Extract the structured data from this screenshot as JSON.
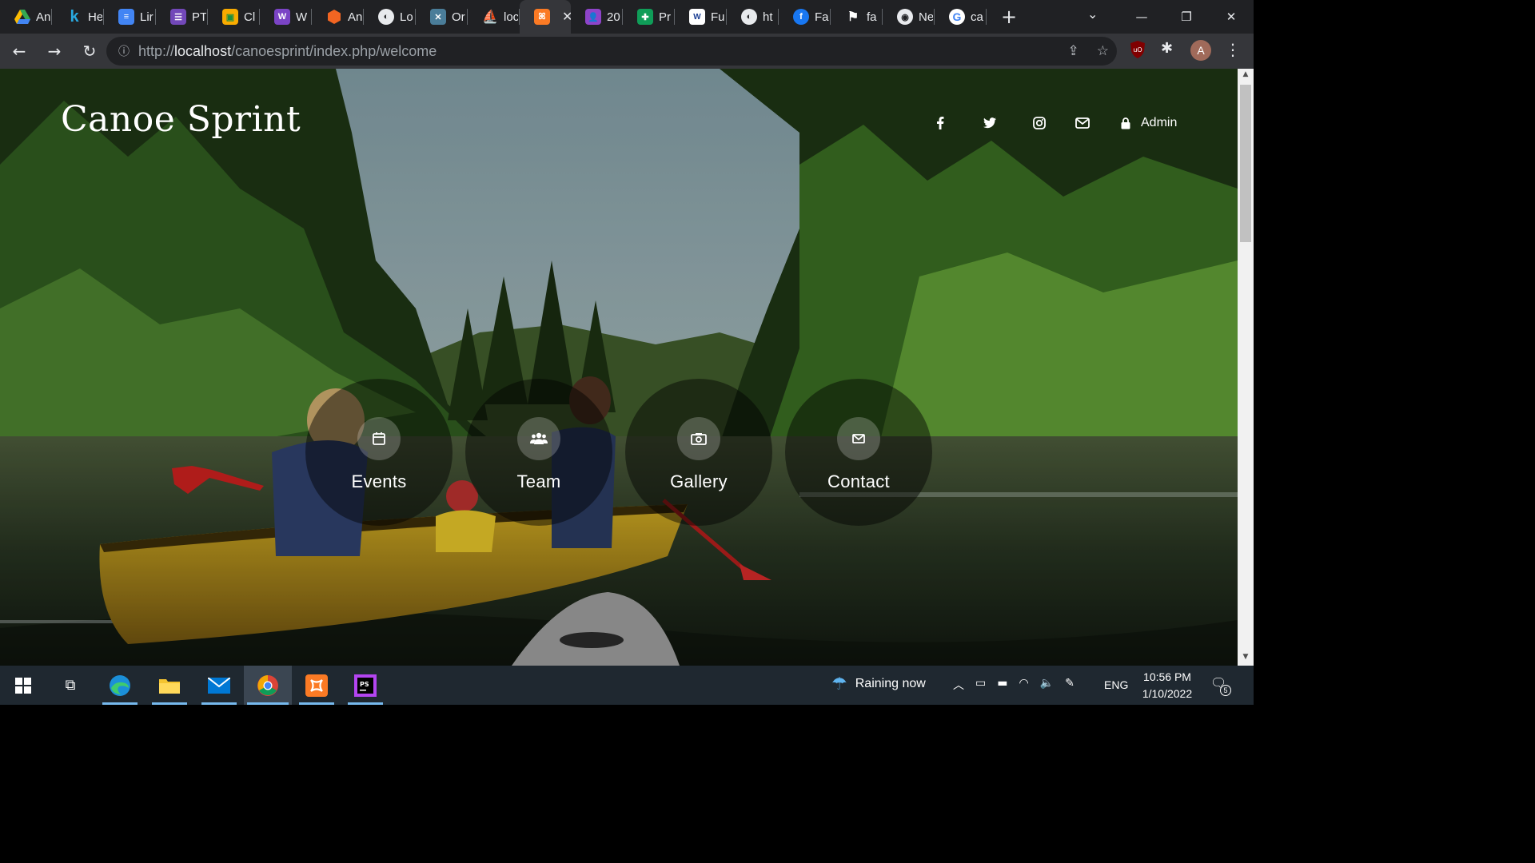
{
  "browser": {
    "tabs": [
      {
        "title": "An",
        "icon": "google-drive-icon",
        "color": "#1a73e8"
      },
      {
        "title": "He",
        "icon": "k-icon",
        "color": "#29a9e0"
      },
      {
        "title": "Lir",
        "icon": "google-docs-icon",
        "color": "#4285f4"
      },
      {
        "title": "PT",
        "icon": "forms-icon",
        "color": "#7248b9"
      },
      {
        "title": "Cl",
        "icon": "classroom-icon",
        "color": "#f9ab00"
      },
      {
        "title": "W",
        "icon": "w-icon",
        "color": "#7b44c6"
      },
      {
        "title": "An",
        "icon": "hexagon-icon",
        "color": "#f26522"
      },
      {
        "title": "Lo",
        "icon": "globe-icon",
        "color": "#e8eaed"
      },
      {
        "title": "Or",
        "icon": "cross-icon",
        "color": "#6fa6c7"
      },
      {
        "title": "loc",
        "icon": "boat-icon",
        "color": "#e0a020"
      }
    ],
    "active_tab": {
      "icon": "xampp-icon",
      "color": "#fb7a24"
    },
    "tabs_after": [
      {
        "title": "20",
        "icon": "contacts-icon",
        "color": "#8e44c9"
      },
      {
        "title": "Pr",
        "icon": "sheets-icon",
        "color": "#0f9d58"
      },
      {
        "title": "Fu",
        "icon": "usu-icon",
        "color": "#1c3f94"
      },
      {
        "title": "ht",
        "icon": "globe-icon",
        "color": "#e8eaed"
      },
      {
        "title": "Fa",
        "icon": "facebook-icon",
        "color": "#1877f2"
      },
      {
        "title": "fa",
        "icon": "flag-icon",
        "color": "#e8eaed"
      },
      {
        "title": "Ne",
        "icon": "chrome-icon",
        "color": "#e8eaed"
      },
      {
        "title": "ca",
        "icon": "google-icon",
        "color": "#ffffff"
      }
    ],
    "url_prefix": "http://",
    "url_host": "localhost",
    "url_path": "/canoesprint/index.php/welcome",
    "avatar_letter": "A"
  },
  "site": {
    "title": "Canoe Sprint",
    "admin_label": "Admin",
    "social": [
      {
        "icon": "facebook-icon"
      },
      {
        "icon": "twitter-icon"
      },
      {
        "icon": "instagram-icon"
      },
      {
        "icon": "email-icon"
      }
    ],
    "menu": [
      {
        "label": "Events",
        "icon": "calendar-icon"
      },
      {
        "label": "Team",
        "icon": "users-icon"
      },
      {
        "label": "Gallery",
        "icon": "camera-icon"
      },
      {
        "label": "Contact",
        "icon": "envelope-icon"
      }
    ]
  },
  "taskbar": {
    "weather": "Raining now",
    "language": "ENG",
    "time": "10:56 PM",
    "date": "1/10/2022",
    "notifications": "5"
  }
}
